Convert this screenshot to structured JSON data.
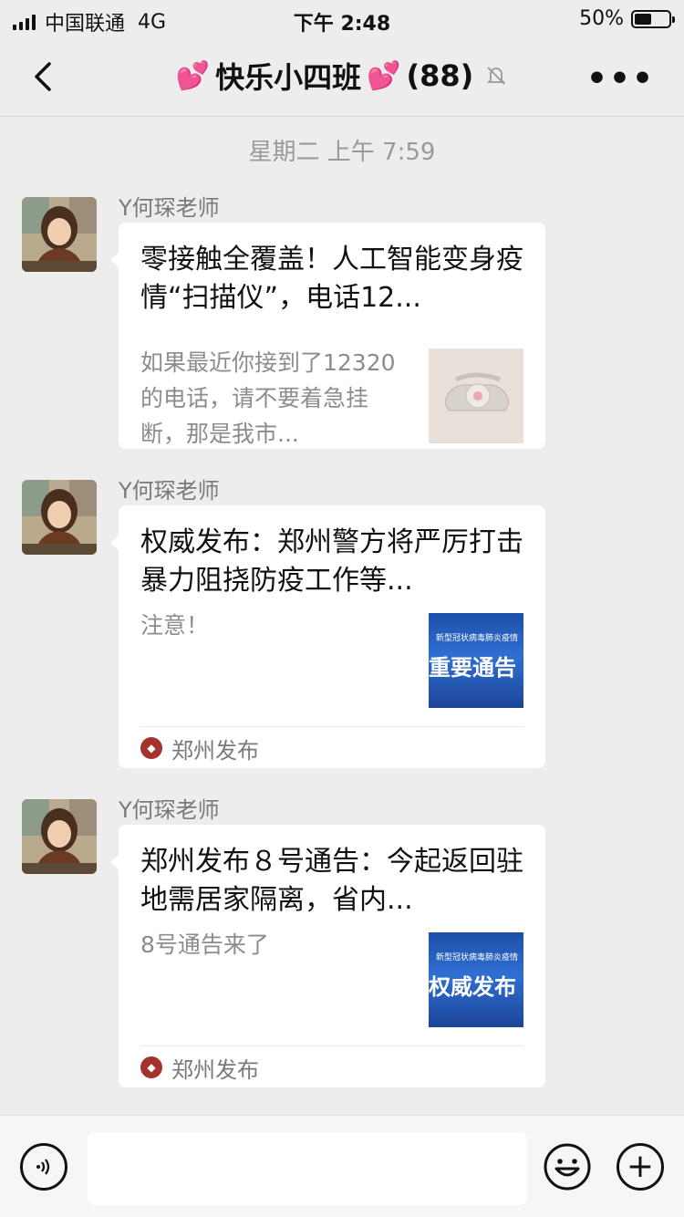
{
  "status_bar": {
    "carrier": "中国联通",
    "network": "4G",
    "time": "下午 2:48",
    "battery": "50%",
    "battery_level": 0.5
  },
  "chat": {
    "title": "快乐小四班",
    "title_emoji": "💕",
    "member_count": "(88)"
  },
  "timestamp": "星期二 上午 7:59",
  "messages": [
    {
      "sender": "Y何琛老师",
      "title": "零接触全覆盖！人工智能变身疫情“扫描仪”，电话12...",
      "description": "如果最近你接到了12320的电话，请不要着急挂断，那是我市...",
      "source": ""
    },
    {
      "sender": "Y何琛老师",
      "title": "权威发布：郑州警方将严厉打击暴力阻挠防疫工作等...",
      "description": "注意！",
      "thumb_small": "新型冠状病毒肺炎疫情",
      "thumb_big": "重要通告",
      "source": "郑州发布"
    },
    {
      "sender": "Y何琛老师",
      "title": "郑州发布８号通告：今起返回驻地需居家隔离，省内...",
      "description": "8号通告来了",
      "thumb_small": "新型冠状病毒肺炎疫情",
      "thumb_big": "权威发布",
      "source": "郑州发布"
    }
  ],
  "input": {
    "placeholder": ""
  },
  "colors": {
    "background": "#ededed",
    "bubble": "#ffffff",
    "accent_pink": "#ff4fa1",
    "source_icon": "#a5322c"
  }
}
